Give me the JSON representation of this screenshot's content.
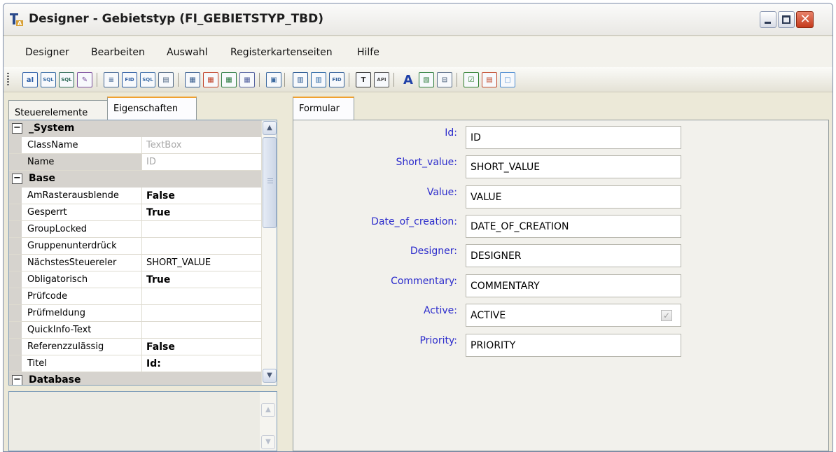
{
  "window": {
    "title": "Designer - Gebietstyp (FI_GEBIETSTYP_TBD)",
    "icon": "designer-app-icon"
  },
  "menu": [
    "Designer",
    "Bearbeiten",
    "Auswahl",
    "Registerkartenseiten",
    "Hilfe"
  ],
  "toolbar": {
    "icons": [
      {
        "name": "textbox-tool-icon",
        "glyph": "aI"
      },
      {
        "name": "sql-combo-tool-icon",
        "glyph": "SQL"
      },
      {
        "name": "sql-grid-tool-icon",
        "glyph": "SQL"
      },
      {
        "name": "wizard-tool-icon",
        "glyph": "✎"
      },
      {
        "name": "listbox-tool-icon",
        "glyph": "≡"
      },
      {
        "name": "fid-tool-icon",
        "glyph": "FID"
      },
      {
        "name": "sql-list-tool-icon",
        "glyph": "SQL"
      },
      {
        "name": "pick-list-tool-icon",
        "glyph": "▤"
      },
      {
        "name": "grid-tool-icon",
        "glyph": "▦"
      },
      {
        "name": "color-grid-tool-icon",
        "glyph": "▦"
      },
      {
        "name": "image-grid-tool-icon",
        "glyph": "▦"
      },
      {
        "name": "edit-grid-tool-icon",
        "glyph": "▦"
      },
      {
        "name": "subform-tool-icon",
        "glyph": "▣"
      },
      {
        "name": "chart-tool-icon",
        "glyph": "▥"
      },
      {
        "name": "data-tool-icon",
        "glyph": "▥"
      },
      {
        "name": "fid-data-tool-icon",
        "glyph": "FID"
      },
      {
        "name": "label-tool-icon",
        "glyph": "T"
      },
      {
        "name": "api-tool-icon",
        "glyph": "API"
      },
      {
        "name": "font-tool-icon",
        "glyph": "A"
      },
      {
        "name": "picture-tool-icon",
        "glyph": "▧"
      },
      {
        "name": "frame-tool-icon",
        "glyph": "⊟"
      },
      {
        "name": "checkbox-tool-icon",
        "glyph": "☑"
      },
      {
        "name": "table-tool-icon",
        "glyph": "▤"
      },
      {
        "name": "shape-tool-icon",
        "glyph": "□"
      }
    ]
  },
  "left_tabs": [
    "Steuerelemente",
    "Eigenschaften"
  ],
  "properties": {
    "categories": [
      {
        "name": "_System",
        "rows": [
          {
            "name": "ClassName",
            "value": "TextBox",
            "dim": true
          },
          {
            "name": "Name",
            "value": "ID",
            "dim": true
          }
        ]
      },
      {
        "name": "Base",
        "rows": [
          {
            "name": "AmRasterausblende",
            "value": "False",
            "bold": true
          },
          {
            "name": "Gesperrt",
            "value": "True",
            "bold": true
          },
          {
            "name": "GroupLocked",
            "value": ""
          },
          {
            "name": "Gruppenunterdrück",
            "value": ""
          },
          {
            "name": "NächstesSteuereler",
            "value": "SHORT_VALUE"
          },
          {
            "name": "Obligatorisch",
            "value": "True",
            "bold": true
          },
          {
            "name": "Prüfcode",
            "value": ""
          },
          {
            "name": "Prüfmeldung",
            "value": ""
          },
          {
            "name": "QuickInfo-Text",
            "value": ""
          },
          {
            "name": "Referenzzulässig",
            "value": "False",
            "bold": true
          },
          {
            "name": "Titel",
            "value": "Id:",
            "bold": true
          }
        ]
      },
      {
        "name": "Database",
        "rows": []
      }
    ]
  },
  "form": {
    "tab": "Formular",
    "fields": [
      {
        "label": "Id:",
        "value": "ID"
      },
      {
        "label": "Short_value:",
        "value": "SHORT_VALUE"
      },
      {
        "label": "Value:",
        "value": "VALUE"
      },
      {
        "label": "Date_of_creation:",
        "value": "DATE_OF_CREATION"
      },
      {
        "label": "Designer:",
        "value": "DESIGNER"
      },
      {
        "label": "Commentary:",
        "value": "COMMENTARY"
      },
      {
        "label": "Active:",
        "value": "ACTIVE",
        "checkbox": true
      },
      {
        "label": "Priority:",
        "value": "PRIORITY"
      }
    ]
  },
  "colors": {
    "label_blue": "#2c2ccc",
    "tab_highlight": "#f0a230",
    "window_bg": "#ece9d8"
  }
}
